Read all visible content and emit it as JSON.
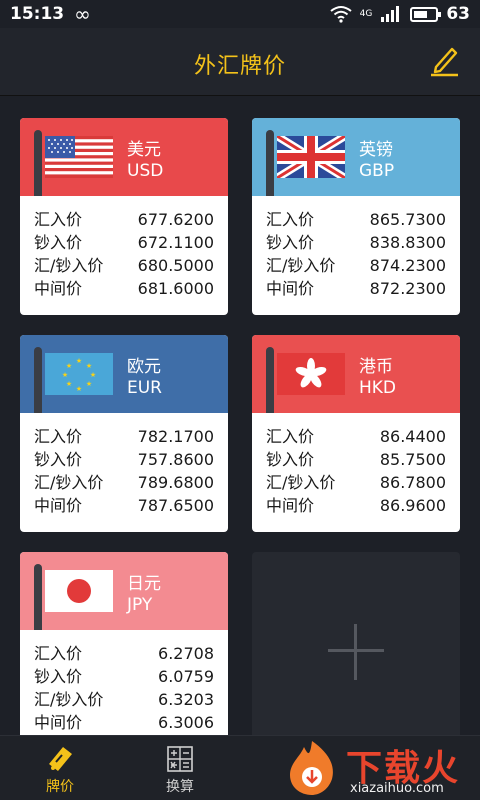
{
  "status": {
    "time": "15:13",
    "infinity": "∞",
    "network": "4G",
    "battery": "63",
    "battery_fraction": 0.63
  },
  "header": {
    "title": "外汇牌价"
  },
  "labels": {
    "buy": "汇入价",
    "cash_buy": "钞入价",
    "sell": "汇/钞入价",
    "mid": "中间价"
  },
  "cards": [
    {
      "name": "美元",
      "code": "USD",
      "color": "#e8494b",
      "values": [
        "677.6200",
        "672.1100",
        "680.5000",
        "681.6000"
      ]
    },
    {
      "name": "英镑",
      "code": "GBP",
      "color": "#64b1d9",
      "values": [
        "865.7300",
        "838.8300",
        "874.2300",
        "872.2300"
      ]
    },
    {
      "name": "欧元",
      "code": "EUR",
      "color": "#3f6ea8",
      "values": [
        "782.1700",
        "757.8600",
        "789.6800",
        "787.6500"
      ]
    },
    {
      "name": "港币",
      "code": "HKD",
      "color": "#e95050",
      "values": [
        "86.4400",
        "85.7500",
        "86.7800",
        "86.9600"
      ]
    },
    {
      "name": "日元",
      "code": "JPY",
      "color": "#f38b91",
      "values": [
        "6.2708",
        "6.0759",
        "6.3203",
        "6.3006"
      ]
    }
  ],
  "nav": {
    "rates_label": "牌价",
    "convert_label": "换算"
  },
  "watermark": {
    "text": "下载火",
    "sub": "xiazaihuo.com"
  },
  "colors": {
    "accent": "#f4c21a",
    "background": "#1d2027"
  }
}
